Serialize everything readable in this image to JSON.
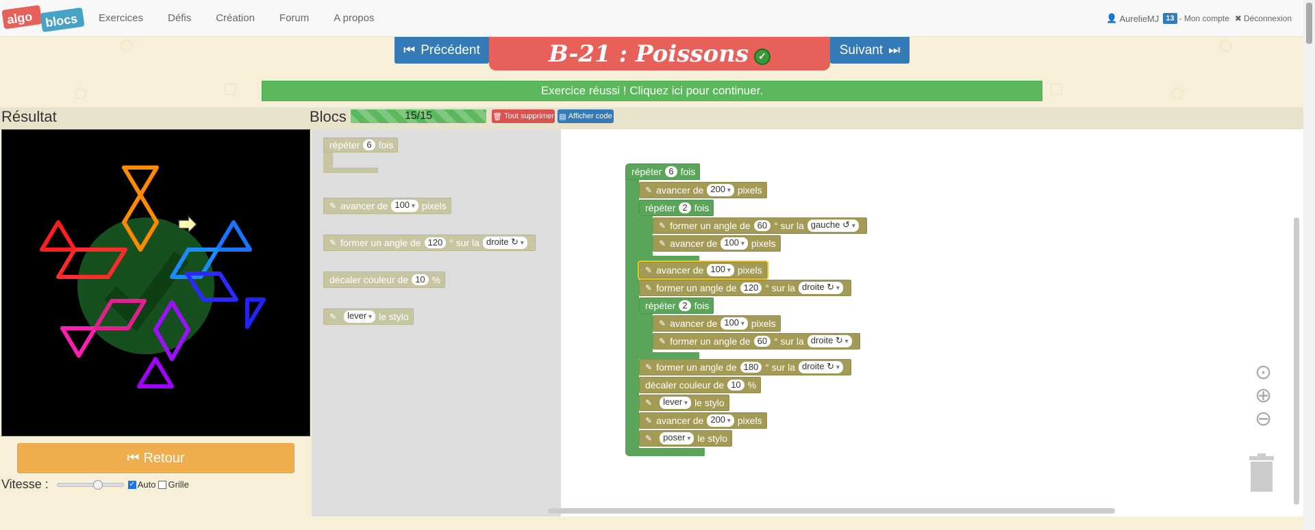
{
  "navbar": {
    "logo_left": "algo",
    "logo_right": "blocs",
    "links": [
      "Exercices",
      "Défis",
      "Création",
      "Forum",
      "A propos"
    ],
    "user": "AurelieMJ",
    "badge": "13",
    "account": "- Mon compte",
    "logout": "Déconnexion"
  },
  "header": {
    "prev_label": "Précédent",
    "next_label": "Suivant",
    "title": "B-21 : Poissons",
    "success_message": "Exercice réussi ! Cliquez ici pour continuer."
  },
  "result": {
    "title": "Résultat",
    "back_label": "Retour",
    "speed_label": "Vitesse :",
    "auto_label": "Auto",
    "auto_checked": true,
    "grid_label": "Grille",
    "grid_checked": false
  },
  "blocs": {
    "title": "Blocs",
    "progress_text": "15/15",
    "progress_value": 1.0,
    "delete_all_label": "Tout supprimer",
    "show_code_label": "Afficher code"
  },
  "toolbox": {
    "repeat": {
      "pre": "répéter",
      "count": "6",
      "post": "fois"
    },
    "forward": {
      "pre": "avancer de",
      "value": "100",
      "post": "pixels"
    },
    "turn": {
      "pre": "former un angle de",
      "value": "120",
      "mid": "° sur la",
      "dir": "droite ↻"
    },
    "color": {
      "pre": "décaler couleur de",
      "value": "10",
      "post": "%"
    },
    "pen": {
      "value": "lever",
      "post": "le stylo"
    }
  },
  "program": {
    "repeat_outer": {
      "pre": "répéter",
      "count": "6",
      "post": "fois"
    },
    "b1": {
      "pre": "avancer de",
      "value": "200",
      "post": "pixels"
    },
    "repeat_a": {
      "pre": "répéter",
      "count": "2",
      "post": "fois"
    },
    "b2": {
      "pre": "former un angle de",
      "value": "60",
      "mid": "° sur la",
      "dir": "gauche ↺"
    },
    "b3": {
      "pre": "avancer de",
      "value": "100",
      "post": "pixels"
    },
    "b4": {
      "pre": "avancer de",
      "value": "100",
      "post": "pixels"
    },
    "b5": {
      "pre": "former un angle de",
      "value": "120",
      "mid": "° sur la",
      "dir": "droite ↻"
    },
    "repeat_b": {
      "pre": "répéter",
      "count": "2",
      "post": "fois"
    },
    "b6": {
      "pre": "avancer de",
      "value": "100",
      "post": "pixels"
    },
    "b7": {
      "pre": "former un angle de",
      "value": "60",
      "mid": "° sur la",
      "dir": "droite ↻"
    },
    "b8": {
      "pre": "former un angle de",
      "value": "180",
      "mid": "° sur la",
      "dir": "droite ↻"
    },
    "b9": {
      "pre": "décaler couleur de",
      "value": "10",
      "post": "%"
    },
    "b10": {
      "value": "lever",
      "post": "le stylo"
    },
    "b11": {
      "pre": "avancer de",
      "value": "200",
      "post": "pixels"
    },
    "b12": {
      "value": "poser",
      "post": "le stylo"
    }
  },
  "colors": {
    "navbar_bg": "#f8f8f8",
    "primary": "#337ab7",
    "title_bg": "#e8605a",
    "success": "#5cb85c",
    "warning": "#f0ad4e",
    "danger": "#d9534f",
    "block_olive": "#a39b55",
    "block_green": "#5ba55b"
  },
  "icons": [
    "user-icon",
    "logout-x-icon",
    "step-backward-icon",
    "step-forward-icon",
    "check-circle-icon",
    "trash-icon",
    "code-icon",
    "fast-backward-icon",
    "pencil-icon",
    "target-icon",
    "zoom-in-icon",
    "zoom-out-icon"
  ]
}
